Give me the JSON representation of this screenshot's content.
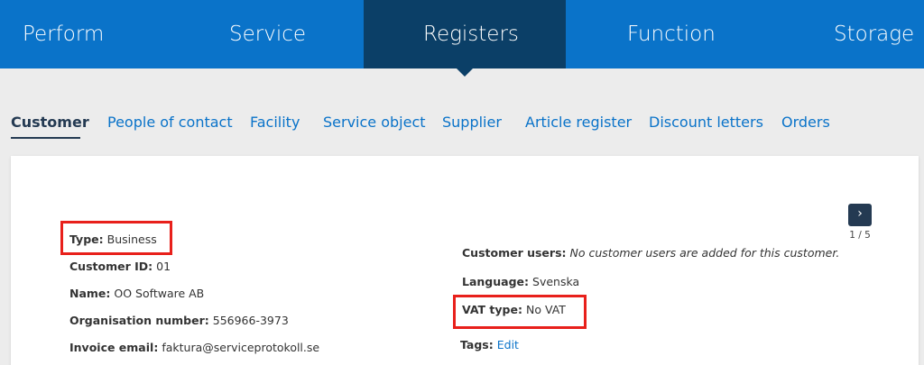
{
  "top_nav": {
    "tabs": [
      {
        "label": "Perform"
      },
      {
        "label": "Service"
      },
      {
        "label": "Registers"
      },
      {
        "label": "Function"
      },
      {
        "label": "Storage"
      }
    ],
    "active": "Registers",
    "colors": {
      "bar": "#0a73c9",
      "active": "#0b3f67"
    }
  },
  "sub_nav": {
    "tabs": [
      {
        "label": "Customer"
      },
      {
        "label": "People of contact"
      },
      {
        "label": "Facility"
      },
      {
        "label": "Service object"
      },
      {
        "label": "Supplier"
      },
      {
        "label": "Article register"
      },
      {
        "label": "Discount letters"
      },
      {
        "label": "Orders"
      }
    ],
    "active": "Customer"
  },
  "customer": {
    "left": [
      {
        "key": "Type:",
        "value": "Business"
      },
      {
        "key": "Customer ID:",
        "value": "01"
      },
      {
        "key": "Name:",
        "value": "OO Software AB"
      },
      {
        "key": "Organisation number:",
        "value": "556966-3973"
      },
      {
        "key": "Invoice email:",
        "value": "faktura@serviceprotokoll.se"
      }
    ],
    "right": [
      {
        "key": "Customer users:",
        "value": "No customer users are added for this customer."
      },
      {
        "key": "Language:",
        "value": "Svenska"
      },
      {
        "key": "VAT type:",
        "value": "No VAT"
      },
      {
        "key": "Tags:",
        "value": "Edit"
      }
    ]
  },
  "pager": {
    "icon": "chevron-right-icon",
    "glyph": "›",
    "text": "1 / 5"
  },
  "highlight_color": "#e8201b"
}
